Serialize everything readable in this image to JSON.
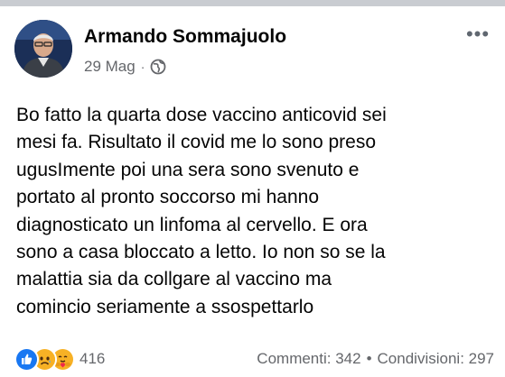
{
  "post": {
    "author": "Armando Sommajuolo",
    "date": "29 Mag",
    "separator": "·",
    "privacy_icon": "globe-icon",
    "more_icon": "more-dots-icon",
    "more_label": "•••",
    "body_lines": [
      "Bo fatto la quarta dose vaccino anticovid sei",
      "mesi fa. Risultato il covid me lo sono preso",
      "ugusImente poi una sera sono svenuto e",
      "portato al pronto soccorso mi hanno",
      "diagnosticato un linfoma al cervello. E ora",
      "sono a casa bloccato a letto. Io non so se la",
      "malattia sia da collgare al vaccino ma",
      "comincio seriamente a ssospettarlo"
    ]
  },
  "footer": {
    "reactions": [
      "like-icon",
      "sad-icon",
      "care-icon"
    ],
    "reaction_count": "416",
    "comments": "Commenti: 342",
    "dot": "•",
    "shares": "Condivisioni: 297"
  },
  "colors": {
    "text": "#050505",
    "secondary": "#65676b",
    "like_blue": "#1877f2",
    "reaction_yellow": "#f7b125"
  }
}
